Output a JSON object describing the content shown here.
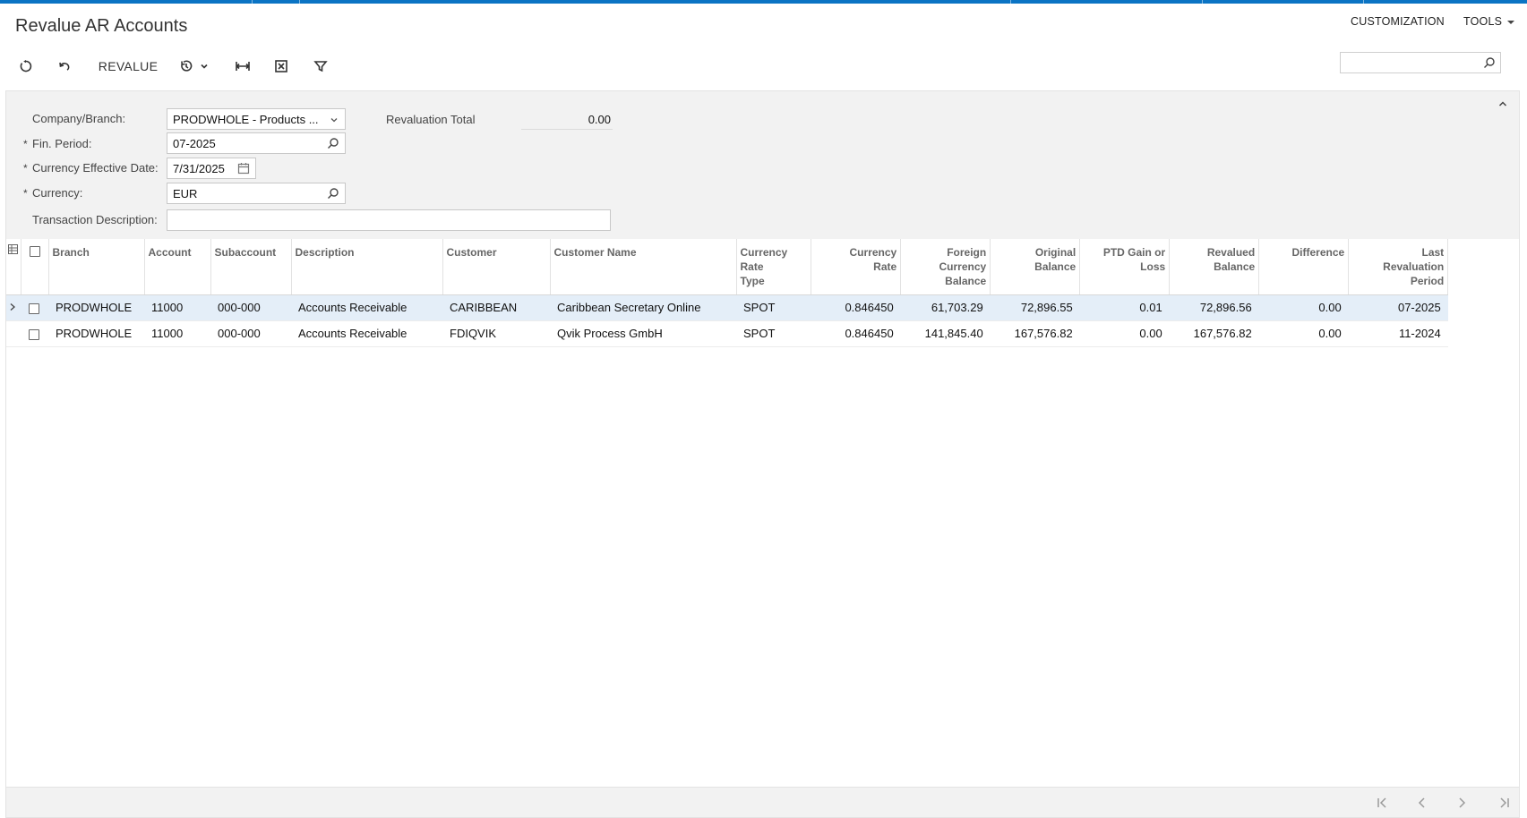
{
  "header": {
    "title": "Revalue AR Accounts",
    "customization_label": "CUSTOMIZATION",
    "tools_label": "TOOLS"
  },
  "toolbar": {
    "revalue_label": "REVALUE",
    "search_placeholder": ""
  },
  "form": {
    "company_branch_label": "Company/Branch:",
    "company_branch_value": "PRODWHOLE - Products ...",
    "fin_period_label": "Fin. Period:",
    "fin_period_value": "07-2025",
    "currency_effective_date_label": "Currency Effective Date:",
    "currency_effective_date_value": "7/31/2025",
    "currency_label": "Currency:",
    "currency_value": "EUR",
    "transaction_description_label": "Transaction Description:",
    "transaction_description_value": "",
    "revaluation_total_label": "Revaluation Total",
    "revaluation_total_value": "0.00",
    "required_mark": "*"
  },
  "grid": {
    "columns": {
      "branch": "Branch",
      "account": "Account",
      "subaccount": "Subaccount",
      "description": "Description",
      "customer": "Customer",
      "customer_name": "Customer Name",
      "currency_rate_type": "Currency Rate Type",
      "currency_rate": "Currency Rate",
      "foreign_currency_balance": "Foreign Currency Balance",
      "original_balance": "Original Balance",
      "ptd_gain_or_loss": "PTD Gain or Loss",
      "revalued_balance": "Revalued Balance",
      "difference": "Difference",
      "last_revaluation_period": "Last Revaluation Period"
    },
    "rows": [
      {
        "branch": "PRODWHOLE",
        "account": "11000",
        "subaccount": "000-000",
        "description": "Accounts Receivable",
        "customer": "CARIBBEAN",
        "customer_name": "Caribbean Secretary Online",
        "currency_rate_type": "SPOT",
        "currency_rate": "0.846450",
        "foreign_currency_balance": "61,703.29",
        "original_balance": "72,896.55",
        "ptd_gain_or_loss": "0.01",
        "revalued_balance": "72,896.56",
        "difference": "0.00",
        "last_revaluation_period": "07-2025"
      },
      {
        "branch": "PRODWHOLE",
        "account": "11000",
        "subaccount": "000-000",
        "description": "Accounts Receivable",
        "customer": "FDIQVIK",
        "customer_name": "Qvik Process GmbH",
        "currency_rate_type": "SPOT",
        "currency_rate": "0.846450",
        "foreign_currency_balance": "141,845.40",
        "original_balance": "167,576.82",
        "ptd_gain_or_loss": "0.00",
        "revalued_balance": "167,576.82",
        "difference": "0.00",
        "last_revaluation_period": "11-2024"
      }
    ]
  },
  "colors": {
    "accent": "#0b74c4",
    "selected_row": "#e4eef8",
    "panel_bg": "#f2f2f2"
  }
}
